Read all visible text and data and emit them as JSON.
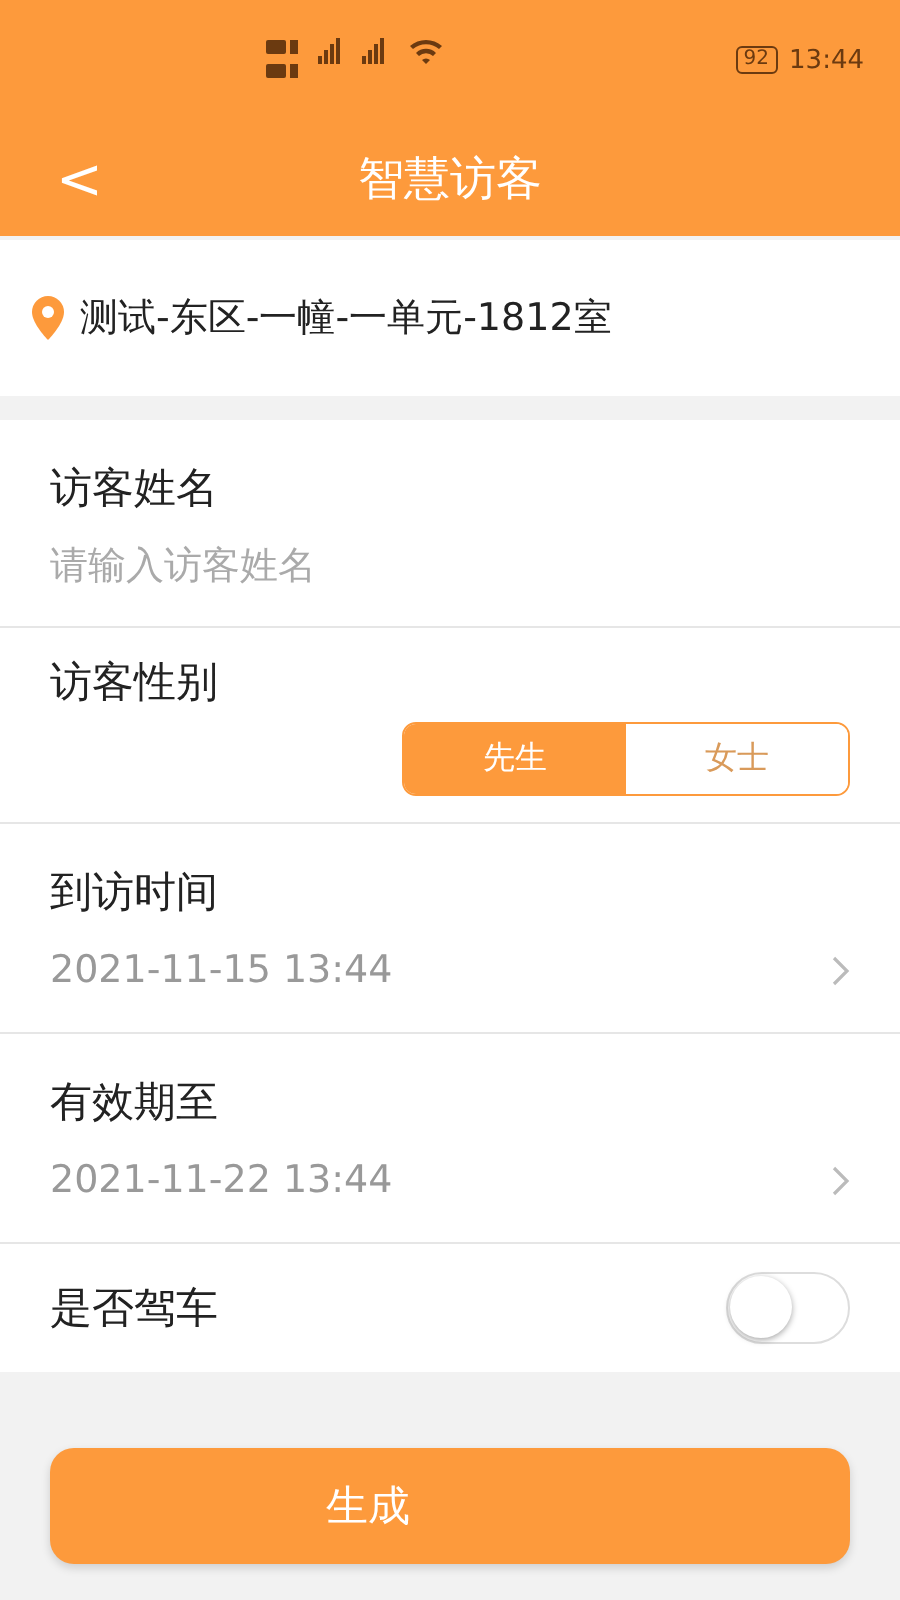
{
  "status_bar": {
    "battery": "92",
    "time": "13:44"
  },
  "nav": {
    "back": "<",
    "title": "智慧访客"
  },
  "address": "测试-东区-一幢-一单元-1812室",
  "form": [
    {
      "kind": "input",
      "label": "访客姓名",
      "placeholder": "请输入访客姓名"
    },
    {
      "kind": "segment",
      "label": "访客性别",
      "options": [
        {
          "label": "先生",
          "selected": true
        },
        {
          "label": "女士",
          "selected": false
        }
      ]
    },
    {
      "kind": "picker",
      "label": "到访时间",
      "value": "2021-11-15 13:44"
    },
    {
      "kind": "picker",
      "label": "有效期至",
      "value": "2021-11-22 13:44"
    },
    {
      "kind": "switch",
      "label": "是否驾车",
      "on": false
    }
  ],
  "submit": "生成"
}
